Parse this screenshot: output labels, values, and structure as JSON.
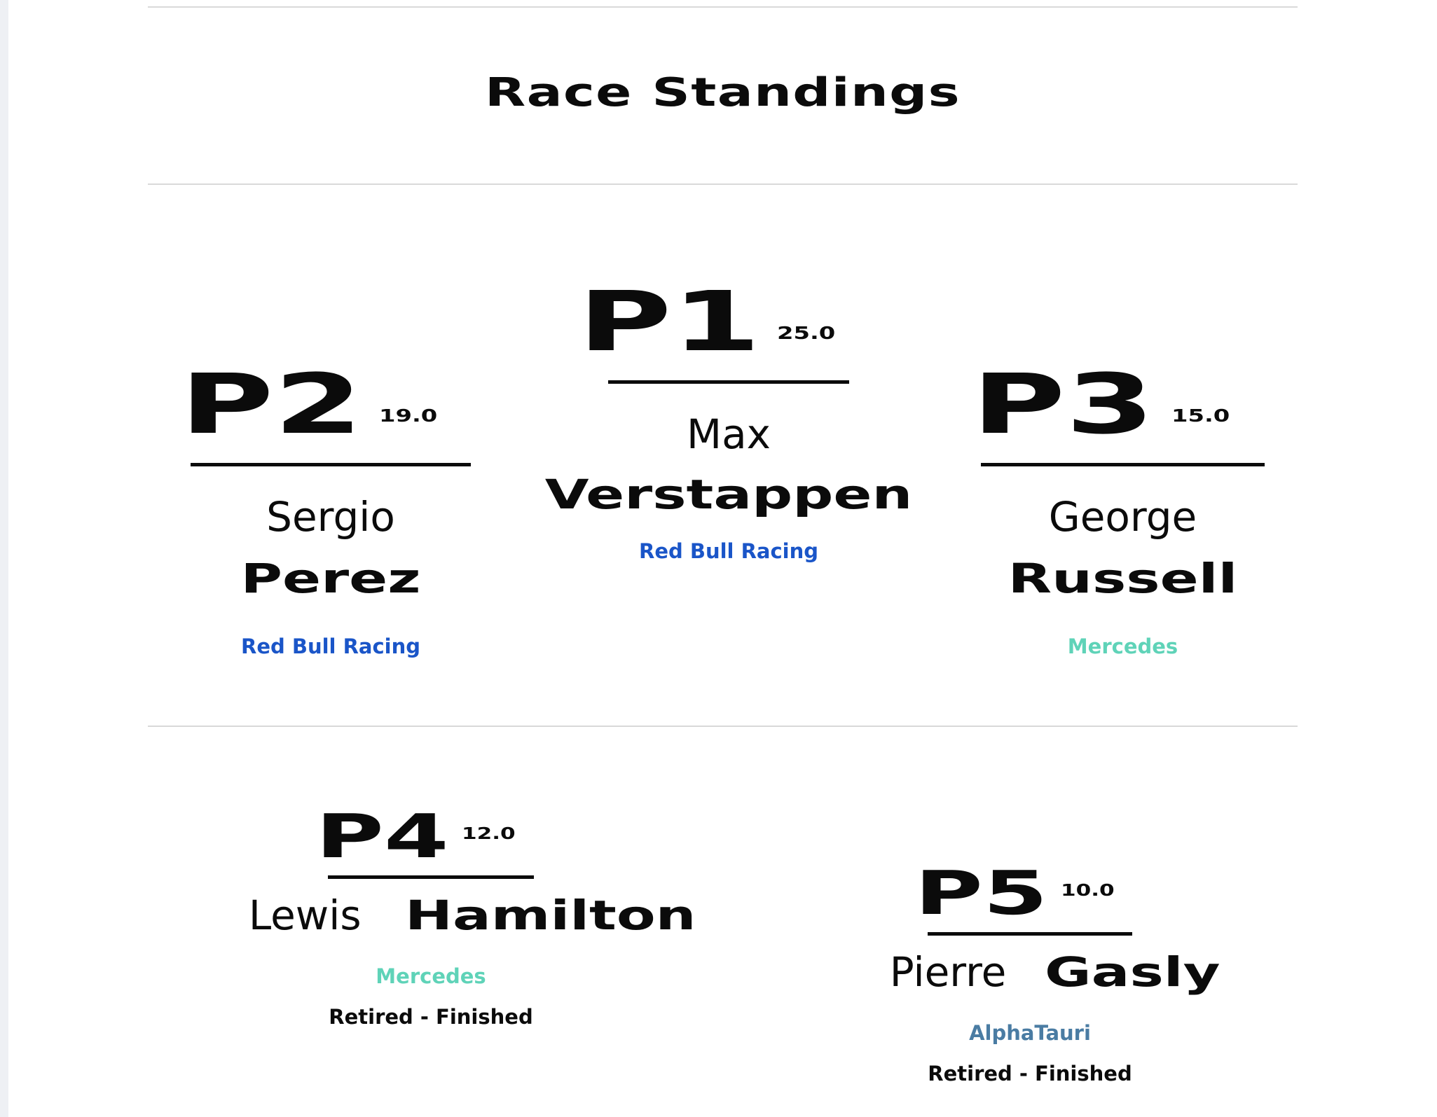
{
  "title": "Race Standings",
  "podium": [
    {
      "position": "P2",
      "points": "19.0",
      "first_name": "Sergio",
      "last_name": "Perez",
      "team": "Red Bull Racing",
      "team_color": "#1a55c8"
    },
    {
      "position": "P1",
      "points": "25.0",
      "first_name": "Max",
      "last_name": "Verstappen",
      "team": "Red Bull Racing",
      "team_color": "#1a55c8"
    },
    {
      "position": "P3",
      "points": "15.0",
      "first_name": "George",
      "last_name": "Russell",
      "team": "Mercedes",
      "team_color": "#5fd3b8"
    }
  ],
  "others": [
    {
      "position": "P4",
      "points": "12.0",
      "first_name": "Lewis",
      "last_name": "Hamilton",
      "team": "Mercedes",
      "team_color": "#5fd3b8",
      "status": "Retired - Finished"
    },
    {
      "position": "P5",
      "points": "10.0",
      "first_name": "Pierre",
      "last_name": "Gasly",
      "team": "AlphaTauri",
      "team_color": "#4a7ca3",
      "status": "Retired - Finished"
    }
  ]
}
